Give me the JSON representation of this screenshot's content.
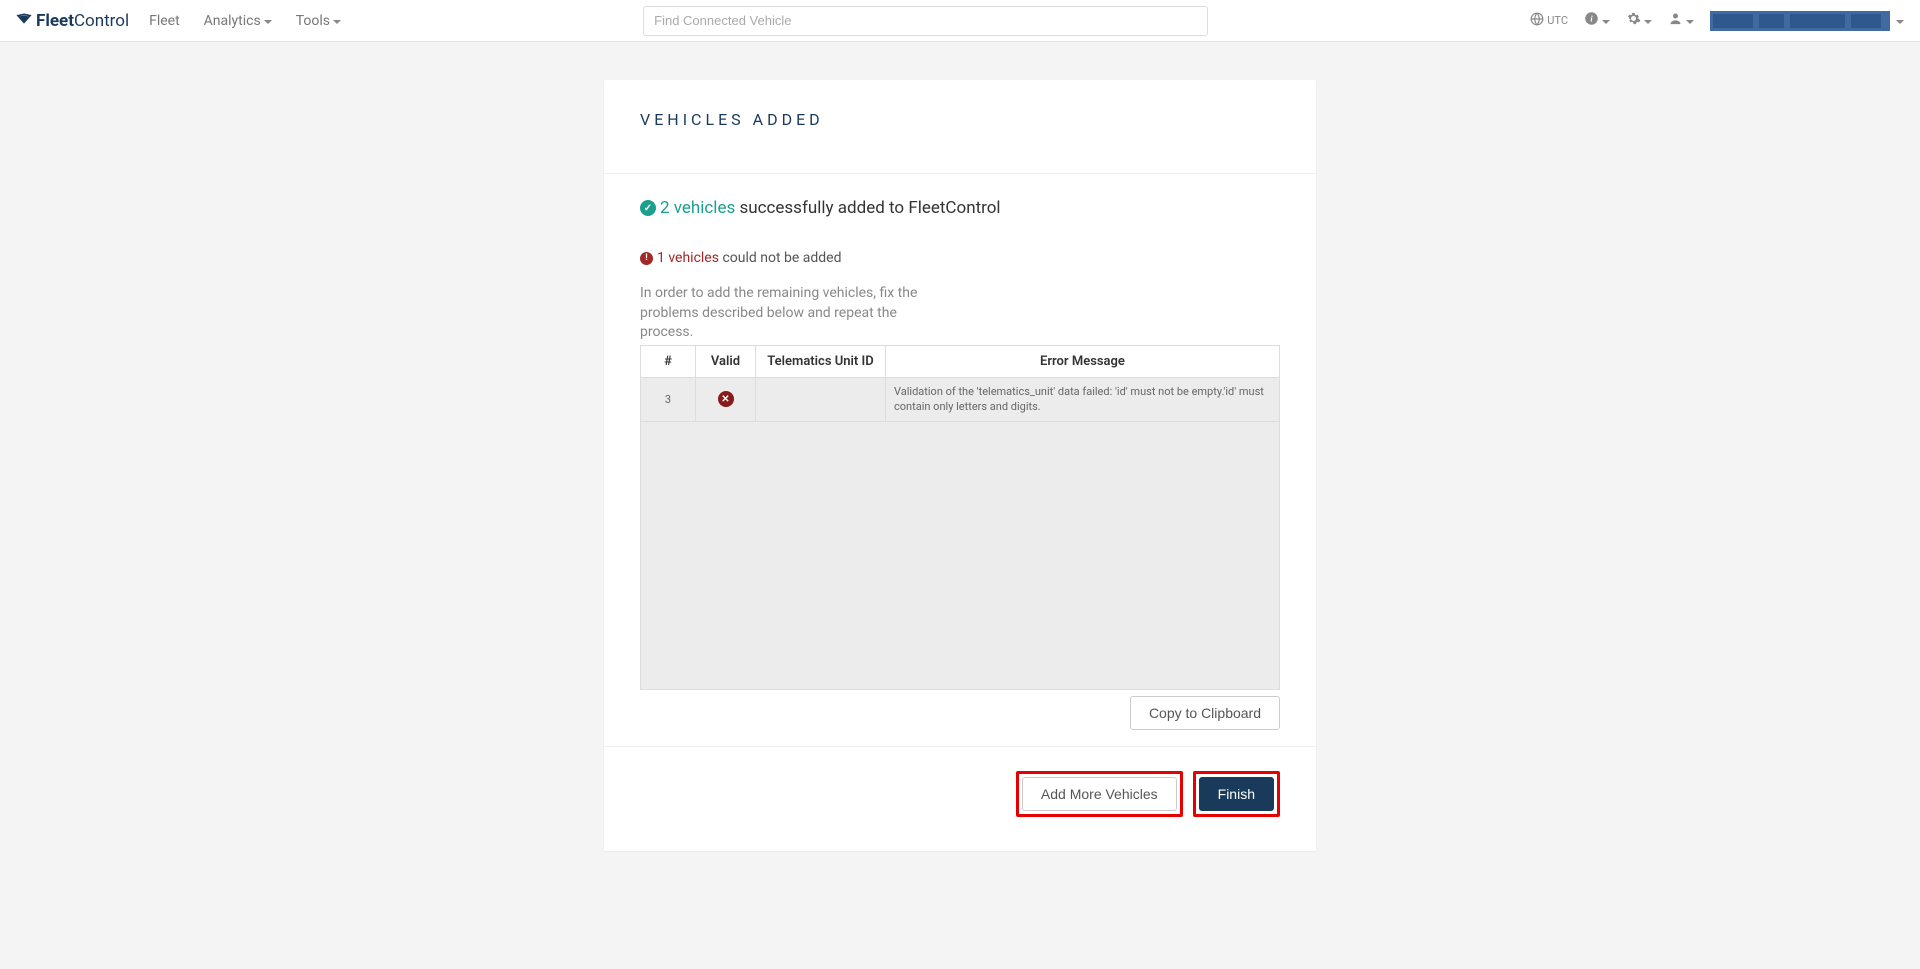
{
  "brand": {
    "prefix": "Fleet",
    "suffix": "Control"
  },
  "nav": {
    "fleet": "Fleet",
    "analytics": "Analytics",
    "tools": "Tools"
  },
  "search": {
    "placeholder": "Find Connected Vehicle"
  },
  "header_controls": {
    "timezone": "UTC"
  },
  "page": {
    "title": "VEHICLES ADDED",
    "success": {
      "highlight": "2 vehicles",
      "rest": " successfully added to FleetControl"
    },
    "failure": {
      "highlight": "1 vehicles",
      "rest": " could not be added"
    },
    "instruction": "In order to add the remaining vehicles, fix the problems described below and repeat the process."
  },
  "table": {
    "headers": {
      "num": "#",
      "valid": "Valid",
      "tid": "Telematics Unit ID",
      "msg": "Error Message"
    },
    "row": {
      "num": "3",
      "tid": "",
      "msg": "Validation of the 'telematics_unit' data failed: 'id' must not be empty.'id' must contain only letters and digits."
    }
  },
  "buttons": {
    "copy": "Copy to Clipboard",
    "add_more": "Add More Vehicles",
    "finish": "Finish"
  }
}
